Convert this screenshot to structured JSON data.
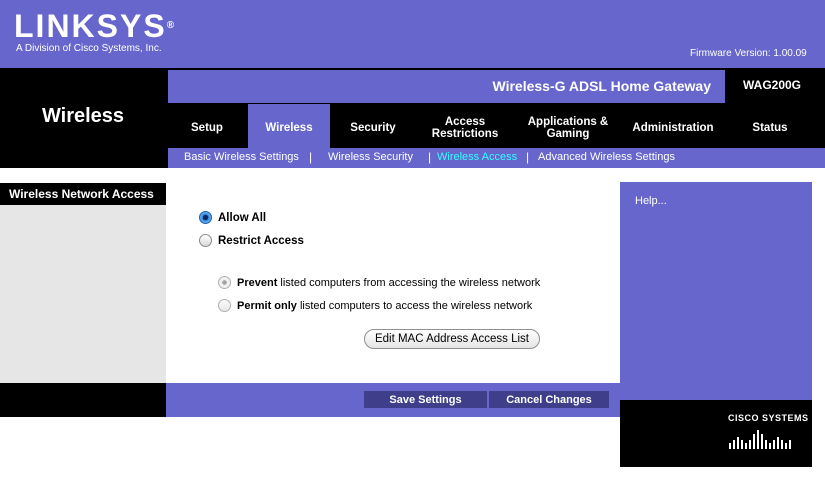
{
  "header": {
    "brand": "LINKSYS",
    "brand_mark": "®",
    "subtitle": "A Division of Cisco Systems, Inc.",
    "firmware": "Firmware Version: 1.00.09",
    "product_name": "Wireless-G ADSL Home Gateway",
    "model": "WAG200G"
  },
  "section_title": "Wireless",
  "tabs": [
    {
      "label": "Setup",
      "active": false
    },
    {
      "label": "Wireless",
      "active": true
    },
    {
      "label": "Security",
      "active": false
    },
    {
      "label": "Access\nRestrictions",
      "active": false
    },
    {
      "label": "Applications &\nGaming",
      "active": false
    },
    {
      "label": "Administration",
      "active": false
    },
    {
      "label": "Status",
      "active": false
    }
  ],
  "subnav": {
    "items": [
      "Basic Wireless Settings",
      "Wireless Security",
      "Wireless Access",
      "Advanced Wireless Settings"
    ],
    "active": "Wireless Access",
    "separator": "|"
  },
  "sidebar": {
    "label": "Wireless Network Access"
  },
  "access_options": {
    "allow_all": {
      "label": "Allow All",
      "selected": true
    },
    "restrict": {
      "label": "Restrict Access",
      "selected": false
    }
  },
  "restrict_modes": {
    "prevent": {
      "bold": "Prevent",
      "rest": " listed computers from accessing the wireless network",
      "selected": true,
      "enabled": false
    },
    "permit": {
      "bold": "Permit only",
      "rest": " listed computers to access the wireless network",
      "selected": false,
      "enabled": false
    }
  },
  "mac_button": "Edit MAC Address Access List",
  "actions": {
    "save": "Save Settings",
    "cancel": "Cancel Changes"
  },
  "help": {
    "link": "Help..."
  },
  "cisco": {
    "name": "CISCO SYSTEMS"
  },
  "colors": {
    "purple": "#6666cc",
    "active_subnav": "#33ffff",
    "button_dark": "#3e3e8a"
  }
}
